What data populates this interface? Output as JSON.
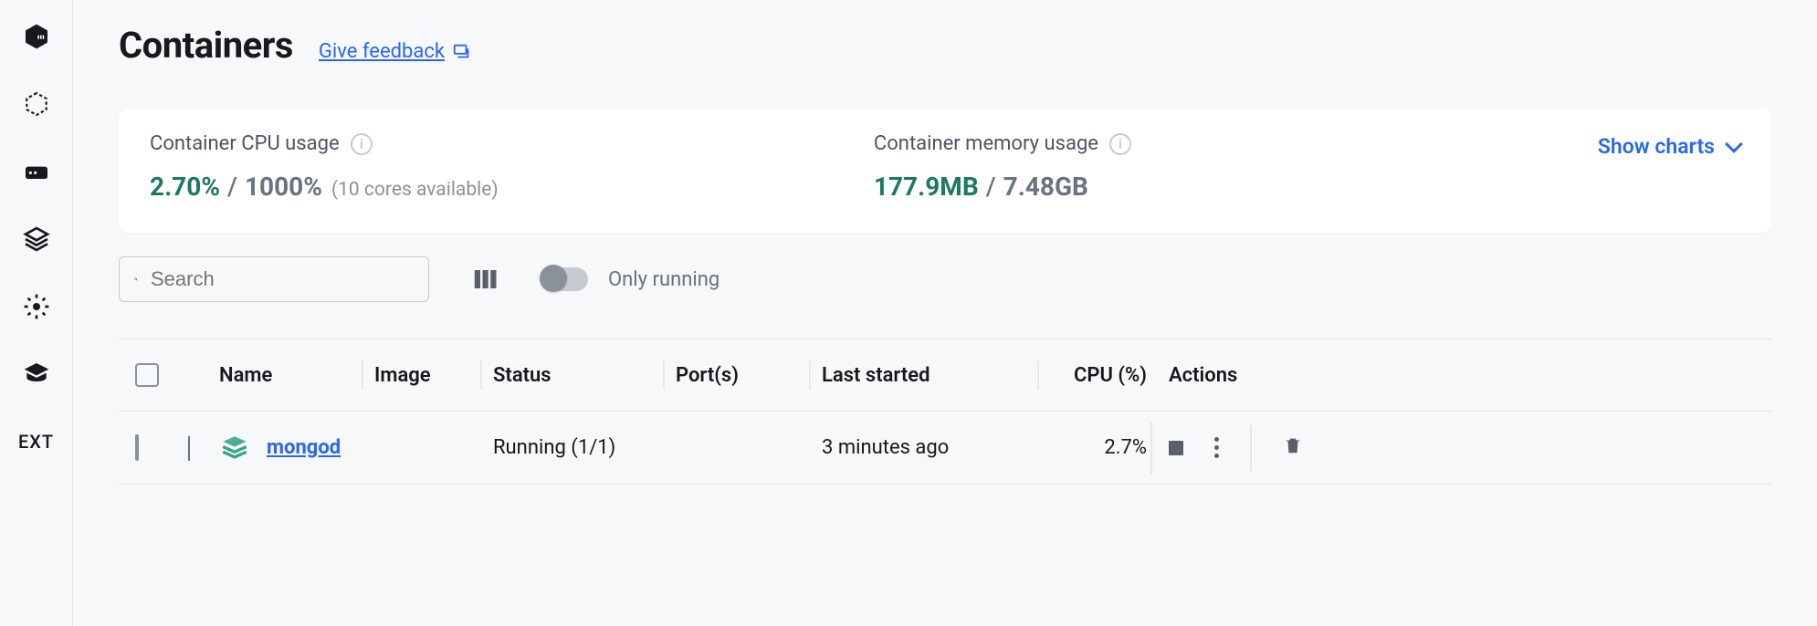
{
  "sidebar": {
    "items": [
      {
        "name": "containers-icon"
      },
      {
        "name": "images-icon"
      },
      {
        "name": "volumes-icon"
      },
      {
        "name": "dev-environments-icon"
      },
      {
        "name": "scout-icon"
      },
      {
        "name": "learning-center-icon"
      }
    ],
    "ext_label": "EXT"
  },
  "header": {
    "title": "Containers",
    "feedback_label": "Give feedback"
  },
  "stats": {
    "cpu": {
      "label": "Container CPU usage",
      "used": "2.70%",
      "sep": "/",
      "total": "1000%",
      "sub": "(10 cores available)"
    },
    "mem": {
      "label": "Container memory usage",
      "used": "177.9MB",
      "sep": "/",
      "total": "7.48GB"
    },
    "show_charts": "Show charts"
  },
  "controls": {
    "search_placeholder": "Search",
    "only_running": "Only running"
  },
  "table": {
    "headers": {
      "name": "Name",
      "image": "Image",
      "status": "Status",
      "ports": "Port(s)",
      "last_started": "Last started",
      "cpu": "CPU (%)",
      "actions": "Actions"
    },
    "rows": [
      {
        "name": "mongod",
        "image": "",
        "status": "Running (1/1)",
        "ports": "",
        "last_started": "3 minutes ago",
        "cpu": "2.7%"
      }
    ]
  }
}
